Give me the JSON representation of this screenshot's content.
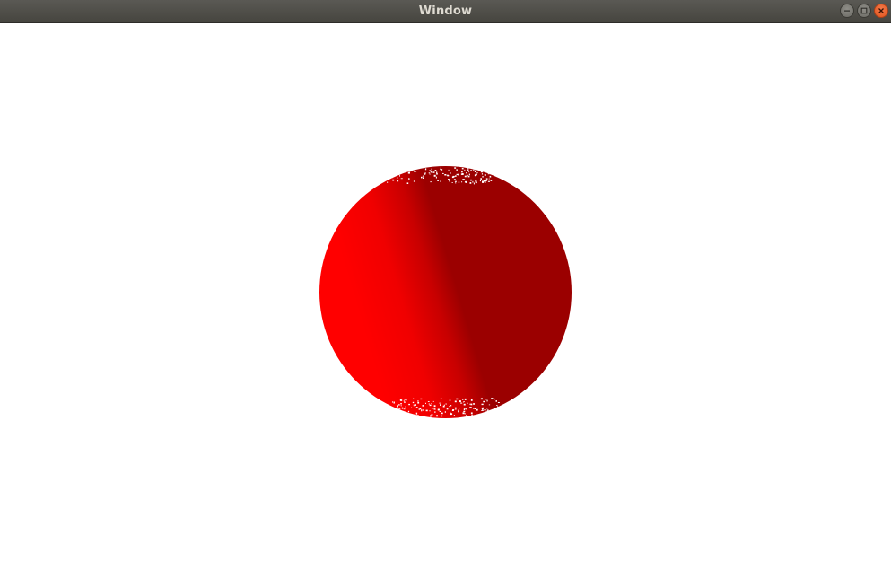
{
  "window": {
    "title": "Window",
    "controls": {
      "minimize_icon": "minimize-icon",
      "maximize_icon": "maximize-icon",
      "close_icon": "close-icon"
    }
  },
  "scene": {
    "object": "sphere",
    "colors": {
      "lit": "#ff0000",
      "shadow": "#9b0000",
      "background": "#ffffff"
    }
  }
}
